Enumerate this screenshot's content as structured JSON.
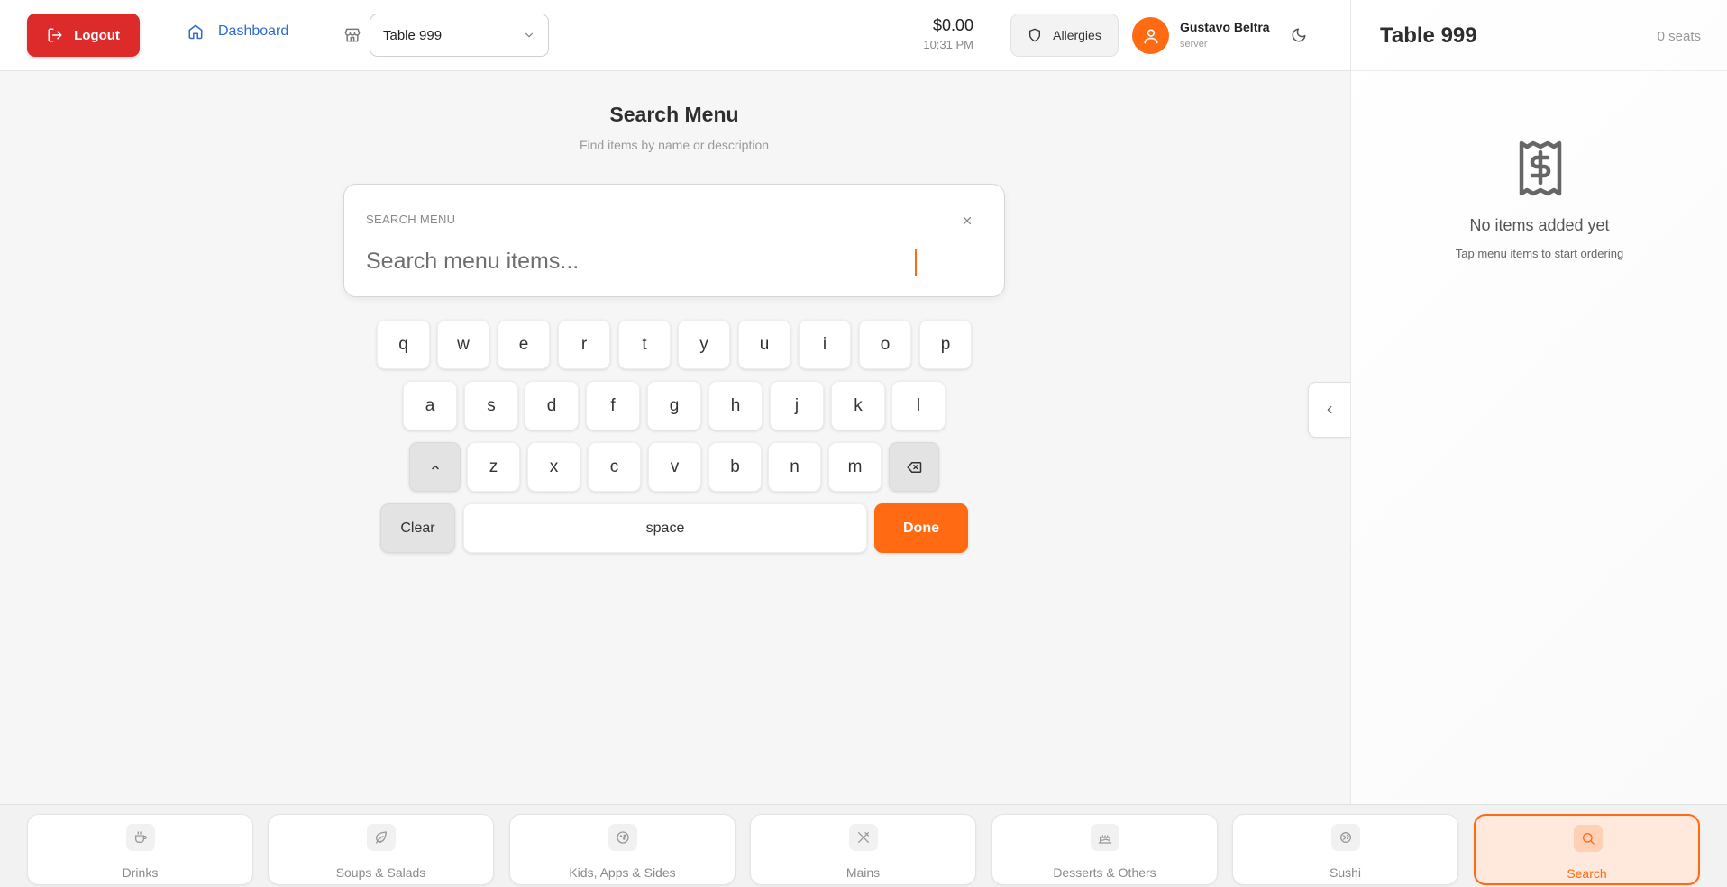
{
  "header": {
    "logout_label": "Logout",
    "dashboard_label": "Dashboard",
    "table_selected": "Table 999",
    "total": "$0.00",
    "time": "10:31 PM",
    "allergies_label": "Allergies",
    "user_name": "Gustavo Beltra",
    "user_role": "server"
  },
  "search": {
    "title": "Search Menu",
    "subtitle": "Find items by name or description",
    "field_label": "SEARCH MENU",
    "value": "",
    "placeholder": "Search menu items..."
  },
  "keyboard": {
    "row1": [
      "q",
      "w",
      "e",
      "r",
      "t",
      "y",
      "u",
      "i",
      "o",
      "p"
    ],
    "row2": [
      "a",
      "s",
      "d",
      "f",
      "g",
      "h",
      "j",
      "k",
      "l"
    ],
    "row3": [
      "z",
      "x",
      "c",
      "v",
      "b",
      "n",
      "m"
    ],
    "clear_label": "Clear",
    "space_label": "space",
    "done_label": "Done"
  },
  "order_panel": {
    "title": "Table 999",
    "seats": "0 seats",
    "empty_title": "No items added yet",
    "empty_subtitle": "Tap menu items to start ordering"
  },
  "bottom_nav": {
    "items": [
      {
        "label": "Drinks",
        "icon": "coffee-icon"
      },
      {
        "label": "Soups & Salads",
        "icon": "leaf-icon"
      },
      {
        "label": "Kids, Apps & Sides",
        "icon": "cookie-icon"
      },
      {
        "label": "Mains",
        "icon": "utensils-crossed-icon"
      },
      {
        "label": "Desserts & Others",
        "icon": "cake-icon"
      },
      {
        "label": "Sushi",
        "icon": "fish-icon"
      },
      {
        "label": "Search",
        "icon": "search-icon"
      }
    ],
    "active": "Search"
  },
  "colors": {
    "accent": "#ff6a13",
    "logout": "#dd2a2a",
    "link": "#2e6bd0"
  }
}
